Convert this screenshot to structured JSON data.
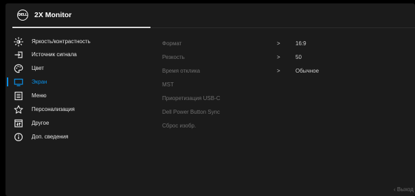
{
  "header": {
    "logo_text": "DELL",
    "title": "2X Monitor"
  },
  "menu": {
    "active_index": 3,
    "items": [
      {
        "label": "Яркость/контрастность",
        "icon": "brightness-icon"
      },
      {
        "label": "Источник сигнала",
        "icon": "input-source-icon"
      },
      {
        "label": "Цвет",
        "icon": "color-palette-icon"
      },
      {
        "label": "Экран",
        "icon": "display-icon"
      },
      {
        "label": "Меню",
        "icon": "menu-list-icon"
      },
      {
        "label": "Персонализация",
        "icon": "star-icon"
      },
      {
        "label": "Другое",
        "icon": "other-settings-icon"
      },
      {
        "label": "Доп. сведения",
        "icon": "info-icon"
      }
    ]
  },
  "options": [
    {
      "label": "Формат",
      "arrow": ">",
      "value": "16:9"
    },
    {
      "label": "Резкость",
      "arrow": ">",
      "value": "50"
    },
    {
      "label": "Время отклика",
      "arrow": ">",
      "value": "Обычное"
    },
    {
      "label": "MST"
    },
    {
      "label": "Приоретизация USB-C"
    },
    {
      "label": "Dell Power Button Sync"
    },
    {
      "label": "Сброс изобр."
    }
  ],
  "footer": {
    "exit_label": "‹ Выход"
  },
  "colors": {
    "accent": "#0a8fe6",
    "panel": "#1b1b1b",
    "background": "#000000",
    "disabled_text": "#6f6f6f"
  }
}
